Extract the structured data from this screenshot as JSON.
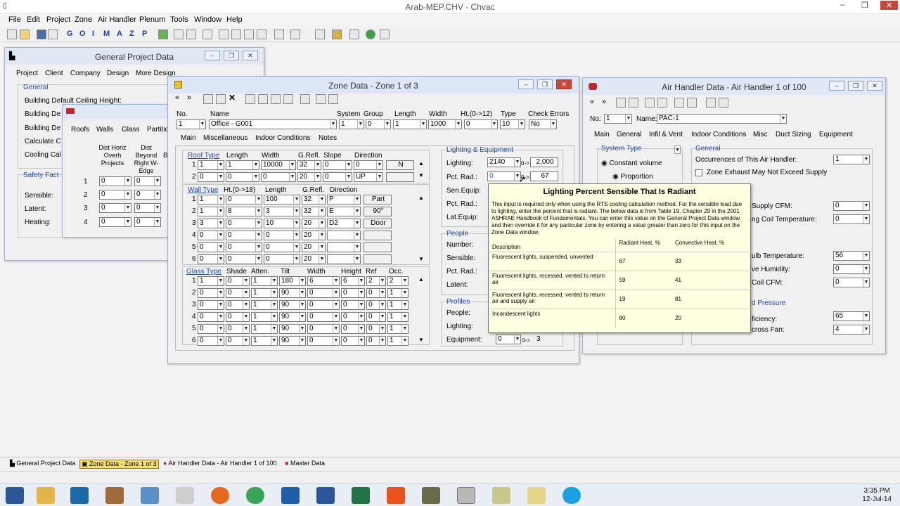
{
  "app": {
    "title": "Arab-MEP.CHV - Chvac",
    "menu": [
      "File",
      "Edit",
      "Project",
      "Zone",
      "Air Handler",
      "Plenum",
      "Tools",
      "Window",
      "Help"
    ],
    "toolbar_letters": [
      "G",
      "O",
      "I",
      "M",
      "A",
      "Z",
      "P"
    ]
  },
  "gpd": {
    "title": "General Project Data",
    "tabs": [
      "Project",
      "Client",
      "Company",
      "Design",
      "More Design"
    ],
    "general_label": "General",
    "rows": [
      "Building Default Ceiling Height:",
      "Building De",
      "Building De",
      "Calculate C",
      "Cooling Cal"
    ],
    "safety_label": "Safety Fact",
    "safety_rows": [
      "Sensible:",
      "Latent:",
      "Heating:"
    ]
  },
  "roofs": {
    "tabs": [
      "Roofs",
      "Walls",
      "Glass",
      "Partitic"
    ],
    "col1": "Dist Horiz Overh Projects",
    "col2": "Dist Beyond Right W-Edge",
    "col3": "B",
    "rows": [
      {
        "n": "1",
        "a": "0",
        "b": "0"
      },
      {
        "n": "2",
        "a": "0",
        "b": "0"
      },
      {
        "n": "3",
        "a": "0",
        "b": "0"
      },
      {
        "n": "4",
        "a": "0",
        "b": "0"
      }
    ]
  },
  "zone": {
    "title": "Zone Data - Zone 1 of 3",
    "head_labels": {
      "no": "No.",
      "name": "Name",
      "system": "System",
      "group": "Group",
      "length": "Length",
      "width": "Width",
      "ht": "Ht.(0->12)",
      "type": "Type",
      "check": "Check Errors"
    },
    "head_values": {
      "no": "1",
      "name": "Office - G001",
      "system": "1",
      "group": "0",
      "length": "1",
      "width": "1000",
      "ht": "0",
      "type": "10",
      "check": "No"
    },
    "tabs": [
      "Main",
      "Miscellaneous",
      "Indoor Conditions",
      "Notes"
    ],
    "roof_headers": [
      "Roof Type",
      "Length",
      "Width",
      "G.Refl.",
      "Slope",
      "Direction"
    ],
    "roof_rows": [
      {
        "n": "1",
        "type": "1",
        "length": "1",
        "width": "10000",
        "refl": "32",
        "slope": "0",
        "dir": "0",
        "extra": "N"
      },
      {
        "n": "2",
        "type": "0",
        "length": "0",
        "width": "0",
        "refl": "20",
        "slope": "0",
        "dir": "UP",
        "extra": ""
      }
    ],
    "wall_headers": [
      "Wall Type",
      "Ht.(0->18)",
      "Length",
      "G.Refl.",
      "Direction"
    ],
    "wall_rows": [
      {
        "n": "1",
        "type": "1",
        "ht": "0",
        "length": "100",
        "refl": "32",
        "dir": "P",
        "extra": "Part"
      },
      {
        "n": "2",
        "type": "1",
        "ht": "8",
        "length": "3",
        "refl": "32",
        "dir": "E",
        "extra": "90°"
      },
      {
        "n": "3",
        "type": "3",
        "ht": "0",
        "length": "10",
        "refl": "20",
        "dir": "D2",
        "extra": "Door"
      },
      {
        "n": "4",
        "type": "0",
        "ht": "0",
        "length": "0",
        "refl": "20",
        "dir": "",
        "extra": ""
      },
      {
        "n": "5",
        "type": "0",
        "ht": "0",
        "length": "0",
        "refl": "20",
        "dir": "",
        "extra": ""
      },
      {
        "n": "6",
        "type": "0",
        "ht": "0",
        "length": "0",
        "refl": "20",
        "dir": "",
        "extra": ""
      }
    ],
    "glass_headers": [
      "Glass Type",
      "Shade",
      "Atten.",
      "Tilt",
      "Width",
      "Height",
      "Ref",
      "Occ."
    ],
    "glass_rows": [
      {
        "n": "1",
        "type": "1",
        "shade": "0",
        "atten": "1",
        "tilt": "180",
        "width": "6",
        "height": "6",
        "ref": "2",
        "occ": "2"
      },
      {
        "n": "2",
        "type": "0",
        "shade": "0",
        "atten": "1",
        "tilt": "90",
        "width": "0",
        "height": "0",
        "ref": "0",
        "occ": "1"
      },
      {
        "n": "3",
        "type": "0",
        "shade": "0",
        "atten": "1",
        "tilt": "90",
        "width": "0",
        "height": "0",
        "ref": "0",
        "occ": "1"
      },
      {
        "n": "4",
        "type": "0",
        "shade": "0",
        "atten": "1",
        "tilt": "90",
        "width": "0",
        "height": "0",
        "ref": "0",
        "occ": "1"
      },
      {
        "n": "5",
        "type": "0",
        "shade": "0",
        "atten": "1",
        "tilt": "90",
        "width": "0",
        "height": "0",
        "ref": "0",
        "occ": "1"
      },
      {
        "n": "6",
        "type": "0",
        "shade": "0",
        "atten": "1",
        "tilt": "90",
        "width": "0",
        "height": "0",
        "ref": "0",
        "occ": "1"
      }
    ],
    "lighting": {
      "title": "Lighting & Equipment",
      "lighting_label": "Lighting:",
      "lighting_value": "2140",
      "lighting_range": "0->",
      "lighting_max": "2,000",
      "pct_label": "Pct. Rad.:",
      "pct_value": "0",
      "pct_range": "0->",
      "pct_default": "67",
      "sen_label": "Sen.Equip:",
      "pct2_label": "Pct. Rad.:",
      "lat_label": "Lat.Equip:"
    },
    "people": {
      "title": "People",
      "rows": [
        "Number:",
        "Sensible:",
        "Pct. Rad.:",
        "Latent:"
      ]
    },
    "profiles": {
      "title": "Profiles",
      "rows": [
        "People:",
        "Lighting:",
        "Equipment:"
      ],
      "equip_value": "0",
      "equip_range": "0->",
      "equip_max": "3"
    }
  },
  "tooltip": {
    "title": "Lighting Percent Sensible That Is Radiant",
    "body": "This input is required only when using the RTS cooling calculation method.  For the sensible load due to lighting, enter the percent that is radiant.  The below data is from Table 19, Chapter 29 in the 2001 ASHRAE Handbook of Fundamentals.  You can enter this value on the General Project Data window and then override it for any particular zone by entering a value greater than zero for this input on the Zone Data window.",
    "headers": [
      "Description",
      "Radiant Heat, %",
      "Convective Heat, %"
    ],
    "rows": [
      {
        "desc": "Fluorescent lights, suspended, unvented",
        "rad": "67",
        "conv": "33"
      },
      {
        "desc": "Fluorescent lights, recessed, vented to return air",
        "rad": "59",
        "conv": "41"
      },
      {
        "desc": "Fluorescent lights, recessed, vented to return air and supply air",
        "rad": "19",
        "conv": "81"
      },
      {
        "desc": "Incandescent lights",
        "rad": "80",
        "conv": "20"
      }
    ]
  },
  "ahu": {
    "title": "Air Handler Data - Air Handler 1 of 100",
    "no_label": "No:",
    "no_value": "1",
    "name_label": "Name:",
    "name_value": "PAC-1",
    "tabs": [
      "Main",
      "General",
      "Infil & Vent",
      "Indoor Conditions",
      "Misc",
      "Duct Sizing",
      "Equipment"
    ],
    "system_type": "System Type",
    "constant_volume": "Constant volume",
    "proportion": "Proportion",
    "general": "General",
    "occurrences_label": "Occurrences of This Air Handler:",
    "occurrences_value": "1",
    "zone_exhaust": "Zone Exhaust May Not Exceed Supply",
    "supply_cfm": "Supply CFM:",
    "supply_cfm_value": "0",
    "coil_temp": "ng Coil Temperature:",
    "coil_temp_value": "0",
    "bulb_temp": "ulb Temperature:",
    "bulb_temp_value": "56",
    "humidity": "ve Humidity:",
    "humidity_value": "0",
    "coil_cfm": "Coil CFM:",
    "coil_cfm_value": "0",
    "pressure": "d Pressure",
    "efficiency": "ficiency:",
    "efficiency_value": "65",
    "fan": "cross Fan:",
    "fan_value": "4"
  },
  "mdi_tabs": [
    "General Project Data",
    "Zone Data - Zone 1 of 3",
    "Air Handler Data - Air Handler 1 of 100",
    "Master Data"
  ],
  "clock": {
    "time": "3:35 PM",
    "date": "12-Jul-14"
  }
}
